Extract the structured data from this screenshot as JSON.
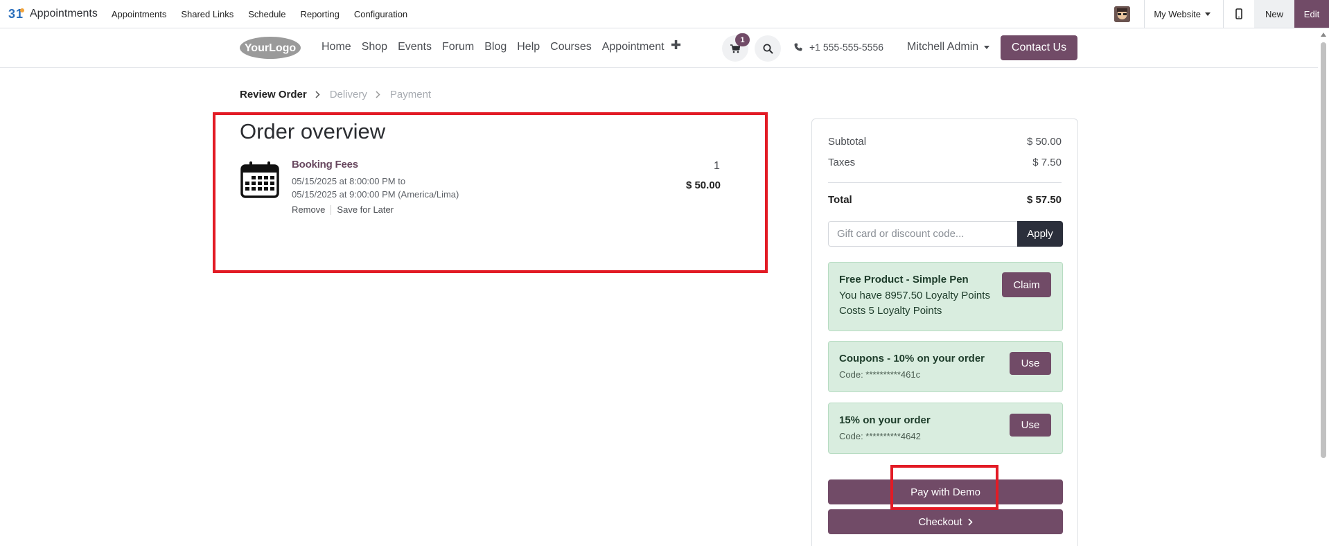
{
  "odoo_bar": {
    "app_name": "Appointments",
    "menu": [
      "Appointments",
      "Shared Links",
      "Schedule",
      "Reporting",
      "Configuration"
    ],
    "website_select": "My Website",
    "new_label": "New",
    "edit_label": "Edit"
  },
  "site_header": {
    "logo_text": "YourLogo",
    "nav": [
      "Home",
      "Shop",
      "Events",
      "Forum",
      "Blog",
      "Help",
      "Courses",
      "Appointment"
    ],
    "cart_count": "1",
    "phone": "+1 555-555-5556",
    "user": "Mitchell Admin",
    "contact_label": "Contact Us"
  },
  "steps": {
    "review": "Review Order",
    "delivery": "Delivery",
    "payment": "Payment"
  },
  "order": {
    "title": "Order overview",
    "item": {
      "name": "Booking Fees",
      "line1": "05/15/2025 at 8:00:00 PM to",
      "line2": "05/15/2025 at 9:00:00 PM (America/Lima)",
      "remove": "Remove",
      "save_later": "Save for Later",
      "qty": "1",
      "price": "$ 50.00"
    }
  },
  "summary": {
    "subtotal_label": "Subtotal",
    "subtotal": "$ 50.00",
    "taxes_label": "Taxes",
    "taxes": "$ 7.50",
    "total_label": "Total",
    "total": "$ 57.50",
    "promo_placeholder": "Gift card or discount code...",
    "apply_label": "Apply",
    "rewards": [
      {
        "title": "Free Product - Simple Pen",
        "line1": "You have 8957.50 Loyalty Points",
        "line2": "Costs 5 Loyalty Points",
        "button": "Claim"
      },
      {
        "title": "Coupons - 10% on your order",
        "code": "Code: **********461c",
        "button": "Use"
      },
      {
        "title": "15% on your order",
        "code": "Code: **********4642",
        "button": "Use"
      }
    ],
    "pay_label": "Pay with Demo",
    "checkout_label": "Checkout"
  },
  "colors": {
    "brand": "#714b67",
    "highlight": "#e21b25",
    "reward_bg": "#d9eddf"
  }
}
